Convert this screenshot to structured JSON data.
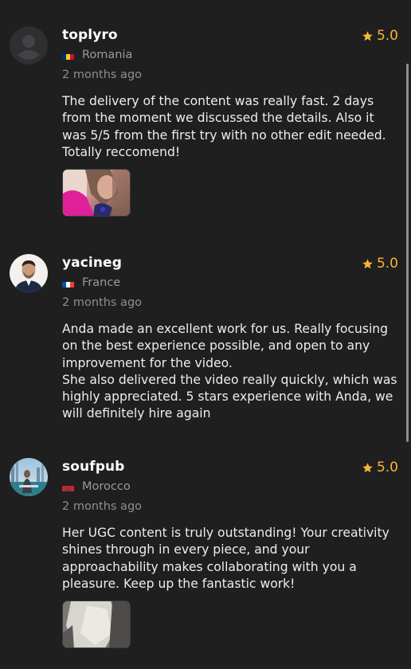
{
  "reviews": [
    {
      "username": "toplyro",
      "rating": "5.0",
      "country": "Romania",
      "flag_colors": [
        "#002b7f",
        "#fcd116",
        "#ce1126"
      ],
      "time": "2 months ago",
      "text_lines": [
        "The delivery of the content was really fast. 2 days from the moment we discussed the details. Also it was 5/5 from the first try with no other edit needed. Totally reccomend!"
      ],
      "avatar": "default-avatar-icon",
      "has_image": true
    },
    {
      "username": "yacineg",
      "rating": "5.0",
      "country": "France",
      "flag_colors": [
        "#0055a4",
        "#ffffff",
        "#ef4135"
      ],
      "time": "2 months ago",
      "text_lines": [
        "Anda made an excellent work for us. Really focusing on the best experience possible, and open to any improvement for the video.",
        "She also delivered the video really quickly, which was highly appreciated. 5 stars experience with Anda, we will definitely hire again"
      ],
      "avatar": "user-photo",
      "has_image": false
    },
    {
      "username": "soufpub",
      "rating": "5.0",
      "country": "Morocco",
      "flag_colors": [
        "#c1272d",
        "#006233"
      ],
      "time": "2 months ago",
      "text_lines": [
        "Her UGC content is truly outstanding! Your creativity shines through in every piece, and your approachability makes collaborating with you a pleasure. Keep up the fantastic work!"
      ],
      "avatar": "user-photo",
      "has_image": true
    }
  ],
  "colors": {
    "background": "#1f1f20",
    "rating_star": "#f7b731",
    "muted_text": "#9a9a9c"
  }
}
